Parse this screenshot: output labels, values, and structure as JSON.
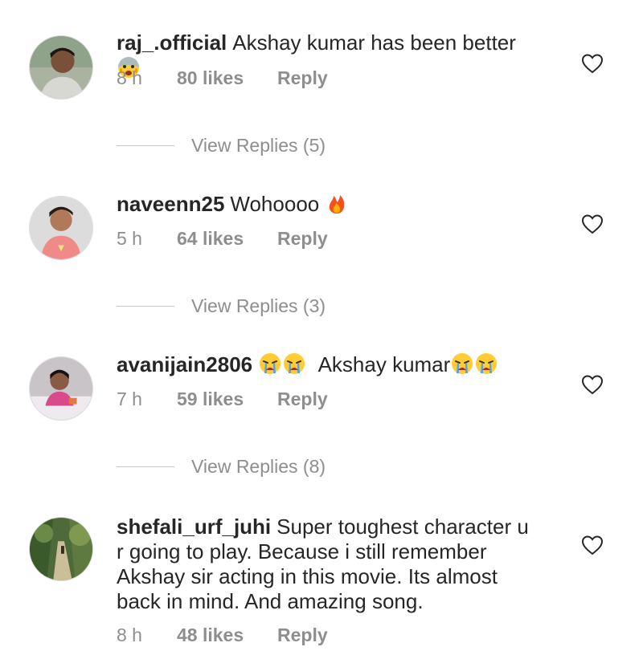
{
  "colors": {
    "text": "#262626",
    "secondary": "#8e8e8e",
    "divider": "#c7c7c7"
  },
  "comments": [
    {
      "username": "raj_.official",
      "text": "Akshay kumar has been better",
      "emojis_after": [
        "fearful-face-emoji"
      ],
      "time": "8 h",
      "likes": "80 likes",
      "reply_label": "Reply",
      "view_replies": "View Replies (5)"
    },
    {
      "username": "naveenn25",
      "text": "Wohoooo",
      "emojis_after": [
        "fire-emoji"
      ],
      "time": "5 h",
      "likes": "64 likes",
      "reply_label": "Reply",
      "view_replies": "View Replies (3)"
    },
    {
      "username": "avanijain2806",
      "text": "Akshay kumar",
      "emojis_before": [
        "crying-face-emoji",
        "crying-face-emoji"
      ],
      "emojis_after": [
        "crying-face-emoji",
        "crying-face-emoji"
      ],
      "time": "7 h",
      "likes": "59 likes",
      "reply_label": "Reply",
      "view_replies": "View Replies (8)"
    },
    {
      "username": "shefali_urf_juhi",
      "text": "Super toughest character u r going to play.  Because i still remember Akshay sir acting in this movie. Its almost back in mind.  And amazing song.",
      "time": "8 h",
      "likes": "48 likes",
      "reply_label": "Reply"
    }
  ]
}
